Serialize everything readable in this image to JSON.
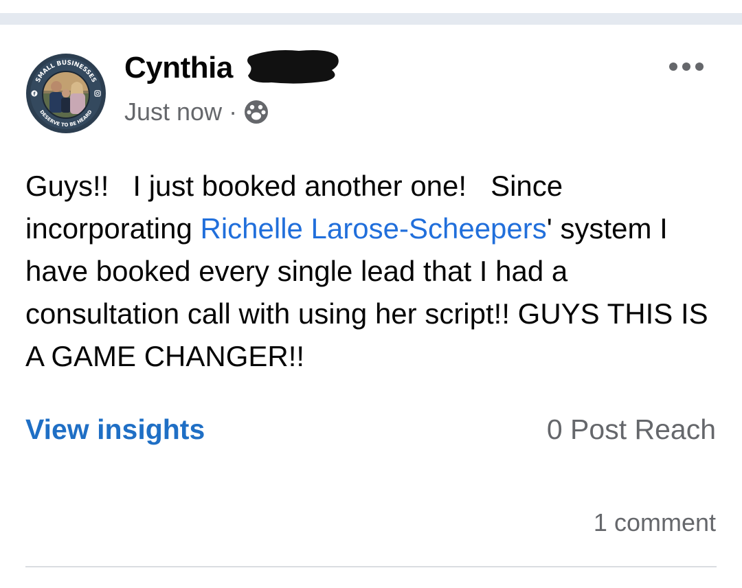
{
  "post": {
    "author": "Cynthia",
    "timestamp": "Just now",
    "separator": "·",
    "audience_icon": "group-icon",
    "avatar_badge": {
      "top_text": "SMALL BUSINESSES",
      "bottom_text": "DESERVE TO BE HEARD"
    },
    "body": {
      "part1": "Guys!!   I just booked another one!   Since incorporating ",
      "mention": "Richelle Larose-Scheepers",
      "part2": "' system I have booked every single lead that I had a consultation call with using her script!! GUYS THIS IS A GAME CHANGER!!"
    },
    "view_insights_label": "View insights",
    "post_reach": "0 Post Reach",
    "comments": "1 comment"
  },
  "colors": {
    "link_blue": "#1f6fc5",
    "mention_blue": "#216fdb",
    "meta_gray": "#65676b",
    "divider": "#e4e9f0"
  }
}
